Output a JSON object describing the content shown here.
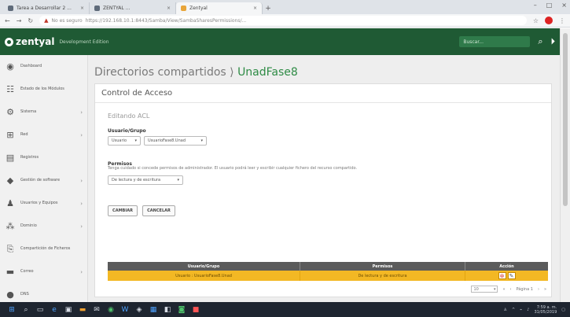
{
  "browser": {
    "tabs": [
      {
        "title": "Tarea a Desarrollar 2 ..."
      },
      {
        "title": "ZENTYAL ..."
      },
      {
        "title": "Zentyal",
        "active": true
      }
    ],
    "new_tab": "+",
    "url_warning": "No es seguro",
    "url": "https://192.168.10.1:8443/Samba/View/SambaSharesPermissions/..."
  },
  "zentyal": {
    "logo": "zentyal",
    "edition": "Development Edition",
    "search_placeholder": "Buscar..."
  },
  "sidebar": {
    "items": [
      {
        "label": "Dashboard",
        "icon": "dashboard-icon",
        "glyph": "◉",
        "arrow": false
      },
      {
        "label": "Estado de los Módulos",
        "icon": "modules-icon",
        "glyph": "☷",
        "arrow": false
      },
      {
        "label": "Sistema",
        "icon": "gear-icon",
        "glyph": "⚙",
        "arrow": true
      },
      {
        "label": "Red",
        "icon": "network-icon",
        "glyph": "⊞",
        "arrow": true
      },
      {
        "label": "Registros",
        "icon": "logs-icon",
        "glyph": "▤",
        "arrow": false
      },
      {
        "label": "Gestión de software",
        "icon": "software-icon",
        "glyph": "◆",
        "arrow": true
      },
      {
        "label": "Usuarios y Equipos",
        "icon": "users-icon",
        "glyph": "♟",
        "arrow": true
      },
      {
        "label": "Dominio",
        "icon": "domain-icon",
        "glyph": "⁂",
        "arrow": true
      },
      {
        "label": "Compartición de Ficheros",
        "icon": "file-share-icon",
        "glyph": "⎘",
        "arrow": false
      },
      {
        "label": "Correo",
        "icon": "mail-icon",
        "glyph": "▬",
        "arrow": true
      },
      {
        "label": "DNS",
        "icon": "dns-icon",
        "glyph": "●",
        "arrow": false
      }
    ]
  },
  "page": {
    "title": "Directorios compartidos",
    "separator": "⟩",
    "crumb": "UnadFase8"
  },
  "panel": {
    "title": "Control de Acceso",
    "edit_heading": "Editando ACL",
    "user_group_label": "Usuario/Grupo",
    "user_type_value": "Usuario",
    "user_value": "UsuarioFase8.Unad",
    "permissions_label": "Permisos",
    "permissions_help": "Tenga cuidado si concede permisos de administrador. El usuario podrá leer y escribir cualquier fichero del recurso compartido.",
    "permissions_value": "De lectura y de escritura",
    "change_button": "CAMBIAR",
    "cancel_button": "CANCELAR"
  },
  "table": {
    "headers": [
      "Usuario/Grupo",
      "Permisos",
      "Acción"
    ],
    "rows": [
      {
        "user": "Usuario : UsuarioFase8.Unad",
        "permission": "De lectura y de escritura"
      }
    ]
  },
  "pager": {
    "per_page": "10",
    "page_label": "Página 1"
  },
  "taskbar": {
    "time": "7:59 a. m.",
    "date": "31/05/2019"
  }
}
